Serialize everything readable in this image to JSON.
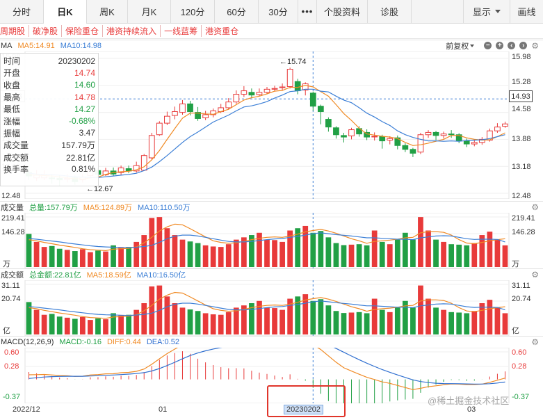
{
  "tabs": [
    "分时",
    "日K",
    "周K",
    "月K",
    "120分",
    "60分",
    "30分",
    "•••",
    "个股资料",
    "诊股"
  ],
  "active_tab": "日K",
  "right_tabs": {
    "display": "显示",
    "draw": "画线"
  },
  "tags": [
    "周期股",
    "破净股",
    "保险重仓",
    "港资持续流入",
    "一线蓝筹",
    "港资重仓"
  ],
  "price_panel": {
    "name": "MA",
    "ma5_label": "MA5:14.91",
    "ma10_label": "MA10:14.98",
    "fuquan": "前复权",
    "yticks": [
      "15.98",
      "15.28",
      "14.58",
      "13.88",
      "13.18",
      "12.48"
    ],
    "crosshair_price": "14.93",
    "high_marker": "←15.74",
    "low_marker": "←12.67"
  },
  "info": {
    "rows": [
      {
        "k": "时间",
        "v": "20230202",
        "c": ""
      },
      {
        "k": "开盘",
        "v": "14.74",
        "c": "up"
      },
      {
        "k": "收盘",
        "v": "14.60",
        "c": "dn"
      },
      {
        "k": "最高",
        "v": "14.78",
        "c": "up"
      },
      {
        "k": "最低",
        "v": "14.27",
        "c": "dn"
      },
      {
        "k": "涨幅",
        "v": "-0.68%",
        "c": "dn"
      },
      {
        "k": "振幅",
        "v": "3.47",
        "c": ""
      },
      {
        "k": "成交量",
        "v": "157.79万",
        "c": ""
      },
      {
        "k": "成交额",
        "v": "22.81亿",
        "c": ""
      },
      {
        "k": "换手率",
        "v": "0.81%",
        "c": ""
      }
    ]
  },
  "volume_panel": {
    "name": "成交量",
    "total": "总量:157.79万",
    "ma5": "MA5:124.89万",
    "ma10": "MA10:110.50万",
    "yticks": [
      "219.41",
      "146.28"
    ],
    "unit": "万"
  },
  "amount_panel": {
    "name": "成交额",
    "total": "总金额:22.81亿",
    "ma5": "MA5:18.59亿",
    "ma10": "MA10:16.50亿",
    "yticks": [
      "31.11",
      "20.74"
    ],
    "unit": "亿"
  },
  "macd_panel": {
    "name": "MACD(12,26,9)",
    "macd": "MACD:-0.16",
    "diff": "DIFF:0.44",
    "dea": "DEA:0.52",
    "yticks": [
      "0.60",
      "0.28",
      "-0.37"
    ]
  },
  "x_labels": {
    "start": "2022/12",
    "mid": "01",
    "end": "03",
    "crosshair_date": "20230202"
  },
  "watermark": "@稀土掘金技术社区",
  "colors": {
    "up": "#e83a3a",
    "down": "#21a045",
    "ma5": "#f08a24",
    "ma10": "#3c7fd6",
    "dea": "#2f6fd0"
  },
  "chart_data": {
    "type": "candlestick",
    "price_range": [
      12.48,
      15.98
    ],
    "candles": [
      [
        13.02,
        12.93,
        13.18,
        12.83
      ],
      [
        12.88,
        12.95,
        13.08,
        12.8
      ],
      [
        12.88,
        12.97,
        13.08,
        12.82
      ],
      [
        12.88,
        12.86,
        12.98,
        12.73
      ],
      [
        12.87,
        12.83,
        12.95,
        12.67
      ],
      [
        12.84,
        12.87,
        12.98,
        12.76
      ],
      [
        12.88,
        12.78,
        12.94,
        12.7
      ],
      [
        12.83,
        12.9,
        12.98,
        12.76
      ],
      [
        12.94,
        13.08,
        13.14,
        12.88
      ],
      [
        13.07,
        12.97,
        13.13,
        12.9
      ],
      [
        12.96,
        13.06,
        13.14,
        12.93
      ],
      [
        13.06,
        12.98,
        13.15,
        12.93
      ],
      [
        13.02,
        13.14,
        13.2,
        12.95
      ],
      [
        13.12,
        13.06,
        13.2,
        13
      ],
      [
        13.06,
        13.2,
        13.3,
        13.02
      ],
      [
        13.08,
        13.46,
        13.5,
        13.06
      ],
      [
        13.4,
        13.98,
        14.05,
        13.36
      ],
      [
        14.0,
        14.3,
        14.35,
        13.97
      ],
      [
        14.3,
        14.48,
        14.6,
        14.25
      ],
      [
        14.5,
        14.6,
        14.73,
        14.4
      ],
      [
        14.58,
        14.8,
        14.9,
        14.52
      ],
      [
        14.8,
        14.6,
        14.88,
        14.5
      ],
      [
        14.58,
        14.42,
        14.72,
        14.36
      ],
      [
        14.44,
        14.52,
        14.62,
        14.38
      ],
      [
        14.52,
        14.62,
        14.68,
        14.45
      ],
      [
        14.6,
        14.7,
        14.8,
        14.56
      ],
      [
        14.7,
        14.85,
        14.95,
        14.65
      ],
      [
        14.85,
        15.05,
        15.15,
        14.8
      ],
      [
        15.05,
        15.14,
        15.26,
        14.98
      ],
      [
        15.1,
        15.03,
        15.2,
        14.95
      ],
      [
        15.04,
        15.1,
        15.2,
        15.0
      ],
      [
        15.1,
        15.18,
        15.24,
        15.06
      ],
      [
        15.18,
        15.2,
        15.27,
        15.12
      ],
      [
        15.22,
        15.24,
        15.33,
        15.14
      ],
      [
        15.25,
        15.7,
        15.74,
        15.2
      ],
      [
        15.38,
        15.14,
        15.45,
        15.05
      ],
      [
        15.16,
        15.32,
        15.36,
        15.02
      ],
      [
        15.08,
        14.74,
        15.12,
        14.62
      ],
      [
        14.74,
        14.6,
        14.78,
        14.27
      ],
      [
        14.4,
        14.2,
        14.45,
        14.08
      ],
      [
        14.18,
        14.0,
        14.22,
        13.9
      ],
      [
        13.98,
        13.94,
        14.05,
        13.8
      ],
      [
        13.97,
        14.13,
        14.18,
        13.88
      ],
      [
        14.16,
        14.02,
        14.22,
        13.95
      ],
      [
        14.06,
        13.94,
        14.14,
        13.86
      ],
      [
        13.96,
        13.96,
        14.06,
        13.85
      ],
      [
        13.95,
        13.84,
        14.0,
        13.64
      ],
      [
        13.86,
        13.9,
        13.96,
        13.75
      ],
      [
        13.92,
        13.72,
        13.98,
        13.62
      ],
      [
        13.72,
        13.62,
        13.78,
        13.55
      ],
      [
        13.62,
        13.52,
        13.66,
        13.42
      ],
      [
        13.55,
        14.0,
        14.05,
        13.5
      ],
      [
        14.0,
        14.06,
        14.12,
        13.92
      ],
      [
        14.06,
        13.98,
        14.1,
        13.86
      ],
      [
        13.98,
        14.02,
        14.08,
        13.9
      ],
      [
        14.02,
        14.0,
        14.12,
        13.92
      ],
      [
        14.0,
        13.84,
        14.04,
        13.78
      ],
      [
        13.84,
        13.76,
        13.9,
        13.68
      ],
      [
        13.76,
        13.8,
        13.88,
        13.7
      ],
      [
        13.8,
        13.88,
        13.94,
        13.74
      ],
      [
        13.86,
        14.1,
        14.16,
        13.82
      ],
      [
        14.1,
        14.2,
        14.3,
        14.05
      ],
      [
        14.22,
        14.28,
        14.34,
        14.18
      ]
    ],
    "ma5": [
      12.96,
      12.95,
      12.94,
      12.93,
      12.91,
      12.88,
      12.86,
      12.85,
      12.88,
      12.9,
      12.97,
      13.02,
      13.04,
      13.05,
      13.09,
      13.17,
      13.35,
      13.59,
      13.88,
      14.16,
      14.43,
      14.56,
      14.56,
      14.54,
      14.53,
      14.6,
      14.66,
      14.78,
      14.9,
      14.96,
      15.0,
      15.06,
      15.13,
      15.15,
      15.23,
      15.23,
      15.28,
      15.24,
      15.12,
      15.0,
      14.78,
      14.55,
      14.37,
      14.17,
      14.02,
      13.99,
      13.96,
      13.94,
      13.9,
      13.8,
      13.72,
      13.74,
      13.78,
      13.83,
      13.88,
      13.98,
      13.98,
      13.92,
      13.88,
      13.86,
      13.87,
      13.95,
      14.05
    ],
    "ma10": [
      13.0,
      12.98,
      12.97,
      12.96,
      12.95,
      12.93,
      12.91,
      12.9,
      12.89,
      12.89,
      12.91,
      12.93,
      12.95,
      12.97,
      13.0,
      13.07,
      13.16,
      13.3,
      13.46,
      13.63,
      13.8,
      13.95,
      14.07,
      14.2,
      14.33,
      14.42,
      14.51,
      14.62,
      14.72,
      14.75,
      14.8,
      14.86,
      14.95,
      15.03,
      15.12,
      15.14,
      15.18,
      15.18,
      15.13,
      15.11,
      15.0,
      14.9,
      14.83,
      14.7,
      14.56,
      14.46,
      14.34,
      14.24,
      14.1,
      14.0,
      13.93,
      13.88,
      13.84,
      13.84,
      13.83,
      13.84,
      13.83,
      13.85,
      13.86,
      13.87,
      13.9,
      13.95,
      14.0
    ],
    "volume_range": [
      0,
      219.41
    ],
    "volume": [
      145,
      110,
      88,
      92,
      80,
      75,
      70,
      78,
      65,
      72,
      68,
      95,
      85,
      88,
      110,
      140,
      215,
      219,
      170,
      140,
      120,
      112,
      105,
      95,
      90,
      88,
      100,
      120,
      130,
      140,
      150,
      120,
      118,
      110,
      160,
      170,
      180,
      150,
      157.8,
      130,
      105,
      96,
      98,
      100,
      95,
      160,
      110,
      100,
      120,
      150,
      120,
      219,
      160,
      120,
      110,
      100,
      98,
      95,
      105,
      140,
      155,
      120,
      95
    ],
    "vol_ma5": [
      120,
      115,
      108,
      102,
      96,
      91,
      86,
      80,
      76,
      74,
      72,
      78,
      80,
      82,
      88,
      106,
      130,
      158,
      176,
      188,
      185,
      168,
      150,
      132,
      115,
      108,
      104,
      106,
      112,
      120,
      126,
      130,
      132,
      130,
      136,
      144,
      154,
      160,
      165,
      158,
      148,
      136,
      124,
      115,
      104,
      112,
      115,
      118,
      122,
      128,
      130,
      150,
      155,
      155,
      152,
      140,
      120,
      105,
      102,
      108,
      115,
      120,
      124
    ],
    "vol_ma10": [
      125,
      122,
      118,
      114,
      110,
      105,
      101,
      97,
      93,
      90,
      88,
      87,
      86,
      85,
      87,
      90,
      95,
      108,
      124,
      135,
      140,
      140,
      136,
      130,
      124,
      118,
      112,
      110,
      110,
      112,
      116,
      120,
      123,
      125,
      130,
      134,
      140,
      146,
      150,
      146,
      142,
      139,
      136,
      132,
      128,
      128,
      126,
      124,
      122,
      122,
      120,
      128,
      132,
      136,
      137,
      136,
      130,
      124,
      121,
      122,
      122,
      121,
      110
    ]
  }
}
